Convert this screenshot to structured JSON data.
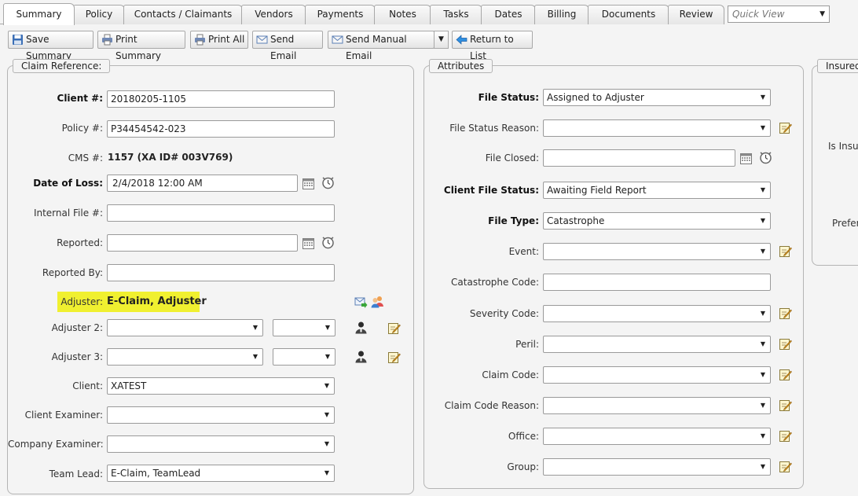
{
  "tabs": [
    {
      "label": "Summary",
      "active": true
    },
    {
      "label": "Policy"
    },
    {
      "label": "Contacts / Claimants"
    },
    {
      "label": "Vendors"
    },
    {
      "label": "Payments"
    },
    {
      "label": "Notes"
    },
    {
      "label": "Tasks"
    },
    {
      "label": "Dates"
    },
    {
      "label": "Billing"
    },
    {
      "label": "Documents"
    },
    {
      "label": "Review"
    }
  ],
  "quick_view": {
    "placeholder": "Quick View"
  },
  "toolbar": {
    "save_summary": "Save Summary",
    "print_summary": "Print Summary",
    "print_all": "Print All",
    "send_email": "Send Email",
    "send_manual_email": "Send Manual Email",
    "return_to_list": "Return to List"
  },
  "claim_reference": {
    "title": "Claim Reference:",
    "client_num_label": "Client #:",
    "client_num": "20180205-1105",
    "policy_num_label": "Policy #:",
    "policy_num": "P34454542-023",
    "cms_label": "CMS #:",
    "cms_value": "1157 (XA ID# 003V769)",
    "date_of_loss_label": "Date of Loss:",
    "date_of_loss": "2/4/2018 12:00 AM",
    "internal_file_label": "Internal File #:",
    "internal_file": "",
    "reported_label": "Reported:",
    "reported": "",
    "reported_by_label": "Reported By:",
    "reported_by": "",
    "adjuster_label": "Adjuster:",
    "adjuster_value": "E-Claim, Adjuster",
    "adjuster2_label": "Adjuster 2:",
    "adjuster3_label": "Adjuster 3:",
    "client_label": "Client:",
    "client": "XATEST",
    "client_examiner_label": "Client Examiner:",
    "client_examiner": "",
    "company_examiner_label": "Company Examiner:",
    "company_examiner": "",
    "team_lead_label": "Team Lead:",
    "team_lead": "E-Claim, TeamLead"
  },
  "attributes": {
    "title": "Attributes",
    "file_status_label": "File Status:",
    "file_status": "Assigned to Adjuster",
    "file_status_reason_label": "File Status Reason:",
    "file_closed_label": "File Closed:",
    "client_file_status_label": "Client File Status:",
    "client_file_status": "Awaiting Field Report",
    "file_type_label": "File Type:",
    "file_type": "Catastrophe",
    "event_label": "Event:",
    "catastrophe_code_label": "Catastrophe Code:",
    "severity_code_label": "Severity Code:",
    "peril_label": "Peril:",
    "claim_code_label": "Claim Code:",
    "claim_code_reason_label": "Claim Code Reason:",
    "office_label": "Office:",
    "group_label": "Group:"
  },
  "insured": {
    "title": "Insured",
    "is_insured_label": "Is Insur",
    "preferred_label": "Prefer"
  },
  "icons": {
    "save": "save-disk-icon",
    "print": "printer-icon",
    "email": "envelope-icon",
    "return": "back-arrow-icon",
    "calendar": "calendar-icon",
    "clock": "clock-icon",
    "edit": "edit-note-icon",
    "person": "person-icon"
  }
}
